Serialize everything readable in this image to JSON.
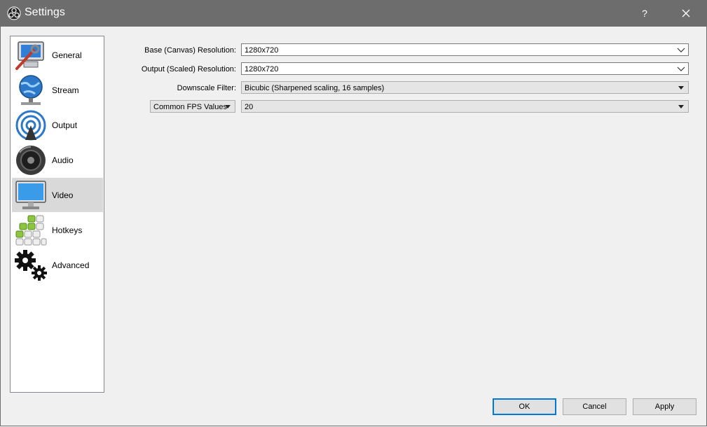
{
  "window": {
    "title": "Settings",
    "help": "?",
    "close": "✕"
  },
  "sidebar": {
    "items": [
      {
        "label": "General"
      },
      {
        "label": "Stream"
      },
      {
        "label": "Output"
      },
      {
        "label": "Audio"
      },
      {
        "label": "Video",
        "selected": true
      },
      {
        "label": "Hotkeys"
      },
      {
        "label": "Advanced"
      }
    ]
  },
  "video": {
    "base_label": "Base (Canvas) Resolution:",
    "base_value": "1280x720",
    "output_label": "Output (Scaled) Resolution:",
    "output_value": "1280x720",
    "downscale_label": "Downscale Filter:",
    "downscale_value": "Bicubic (Sharpened scaling, 16 samples)",
    "fps_type": "Common FPS Values",
    "fps_value": "20"
  },
  "buttons": {
    "ok": "OK",
    "cancel": "Cancel",
    "apply": "Apply"
  },
  "colors": {
    "titlebar": "#6d6d6d",
    "selected": "#d9d9d9",
    "accent": "#0078d7"
  }
}
